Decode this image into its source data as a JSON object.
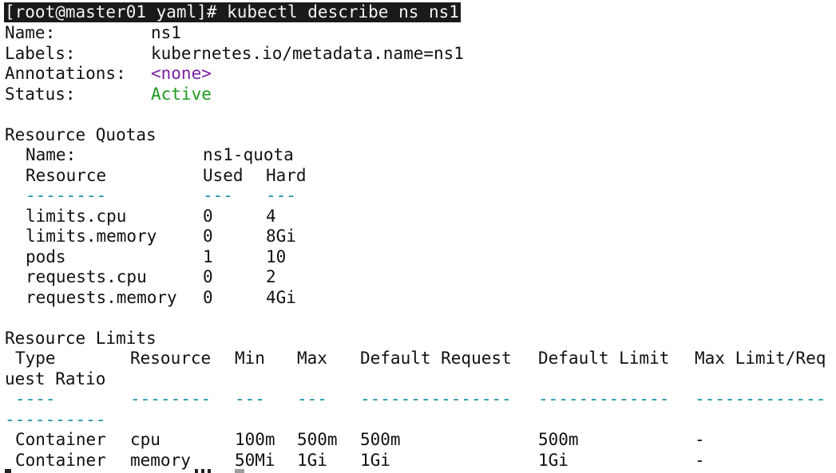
{
  "command": "[root@master01 yaml]# kubectl describe ns ns1",
  "namespace": {
    "name_label": "Name:",
    "name_value": "ns1",
    "labels_label": "Labels:",
    "labels_value": "kubernetes.io/metadata.name=ns1",
    "annotations_label": "Annotations:",
    "annotations_value": "<none>",
    "status_label": "Status:",
    "status_value": "Active"
  },
  "resource_quotas": {
    "heading": "Resource Quotas",
    "name_label": "Name:",
    "name_value": "ns1-quota",
    "col_resource": "Resource",
    "col_used": "Used",
    "col_hard": "Hard",
    "dash_resource": "--------",
    "dash_used": "---",
    "dash_hard": "---",
    "rows": [
      {
        "resource": "limits.cpu",
        "used": "0",
        "hard": "4"
      },
      {
        "resource": "limits.memory",
        "used": "0",
        "hard": "8Gi"
      },
      {
        "resource": "pods",
        "used": "1",
        "hard": "10"
      },
      {
        "resource": "requests.cpu",
        "used": "0",
        "hard": "2"
      },
      {
        "resource": "requests.memory",
        "used": "0",
        "hard": "4Gi"
      }
    ]
  },
  "resource_limits": {
    "heading": "Resource Limits",
    "col_type": "Type",
    "col_resource": "Resource",
    "col_min": "Min",
    "col_max": "Max",
    "col_default_request": "Default Request",
    "col_default_limit": "Default Limit",
    "col_ratio_part1": "Max Limit/Req",
    "col_ratio_part2": "uest Ratio",
    "dash_type": "----",
    "dash_resource": "--------",
    "dash_min": "---",
    "dash_max": "---",
    "dash_default_request": "---------------",
    "dash_default_limit": "-------------",
    "dash_ratio_part1": "-------------",
    "dash_ratio_part2": "----------",
    "rows": [
      {
        "type": "Container",
        "resource": "cpu",
        "min": "100m",
        "max": "500m",
        "default_request": "500m",
        "default_limit": "500m",
        "ratio": "-"
      },
      {
        "type": "Container",
        "resource": "memory",
        "min": "50Mi",
        "max": "1Gi",
        "default_request": "1Gi",
        "default_limit": "1Gi",
        "ratio": "-"
      }
    ]
  }
}
